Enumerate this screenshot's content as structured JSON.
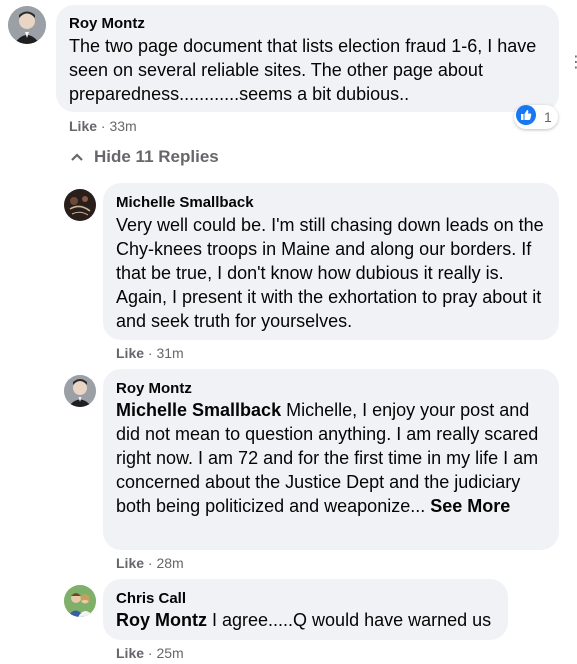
{
  "comment": {
    "author": "Roy Montz",
    "text": "The two page document that lists election fraud 1-6, I have seen on several reliable sites. The other page about preparedness............seems a bit dubious..",
    "like_label": "Like",
    "time": "33m",
    "reaction_count": "1"
  },
  "toggle": {
    "label": "Hide 11 Replies"
  },
  "replies": [
    {
      "author": "Michelle Smallback",
      "text": "Very well could be. I'm still chasing down leads on the Chy-knees troops in Maine and along our borders. If that be true, I don't know how dubious it really is. Again, I present it with the exhortation to pray about it and seek truth for yourselves.",
      "like_label": "Like",
      "time": "31m"
    },
    {
      "author": "Roy Montz",
      "tag": "Michelle Smallback",
      "text": "Michelle, I enjoy your post and did not mean to question anything. I am really scared right now. I am 72 and for the first time in my life I am concerned about the Justice Dept and the judiciary both being politicized and weaponize...",
      "see_more": "See More",
      "like_label": "Like",
      "time": "28m"
    },
    {
      "author": "Chris Call",
      "tag": "Roy Montz",
      "text": "I agree.....Q would have warned us",
      "like_label": "Like",
      "time": "25m"
    }
  ],
  "colors": {
    "bubble": "#f0f2f5",
    "meta": "#65676b",
    "like_reaction": "#1877f2"
  },
  "icons": [
    "avatar-roy-montz",
    "avatar-michelle-smallback",
    "avatar-chris-call",
    "like-reaction-icon",
    "chevron-up-icon",
    "more-options-icon"
  ]
}
